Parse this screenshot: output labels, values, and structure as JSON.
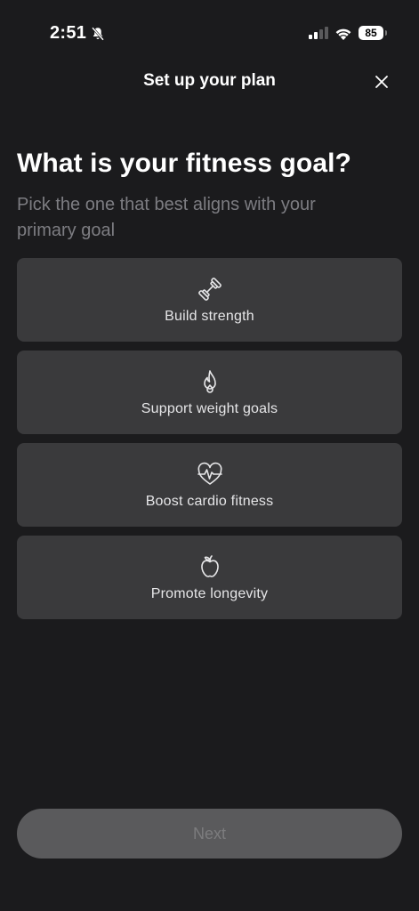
{
  "status_bar": {
    "time": "2:51",
    "battery": "85",
    "icons": [
      "bell-slash-icon",
      "signal-icon",
      "wifi-icon",
      "battery-icon"
    ]
  },
  "header": {
    "title": "Set up your plan",
    "close_icon": "close-icon"
  },
  "question": {
    "title": "What is your fitness goal?",
    "subtitle": "Pick the one that best aligns with your primary goal"
  },
  "options": [
    {
      "label": "Build strength",
      "icon": "dumbbell-icon"
    },
    {
      "label": "Support weight goals",
      "icon": "flame-icon"
    },
    {
      "label": "Boost cardio fitness",
      "icon": "heartbeat-icon"
    },
    {
      "label": "Promote longevity",
      "icon": "apple-icon"
    }
  ],
  "footer": {
    "next_label": "Next"
  },
  "colors": {
    "background": "#1b1b1d",
    "card": "#3a3a3c",
    "subtitle": "#7d7d82",
    "next_button": "#5a5a5c",
    "next_text": "#7c7c7e"
  }
}
